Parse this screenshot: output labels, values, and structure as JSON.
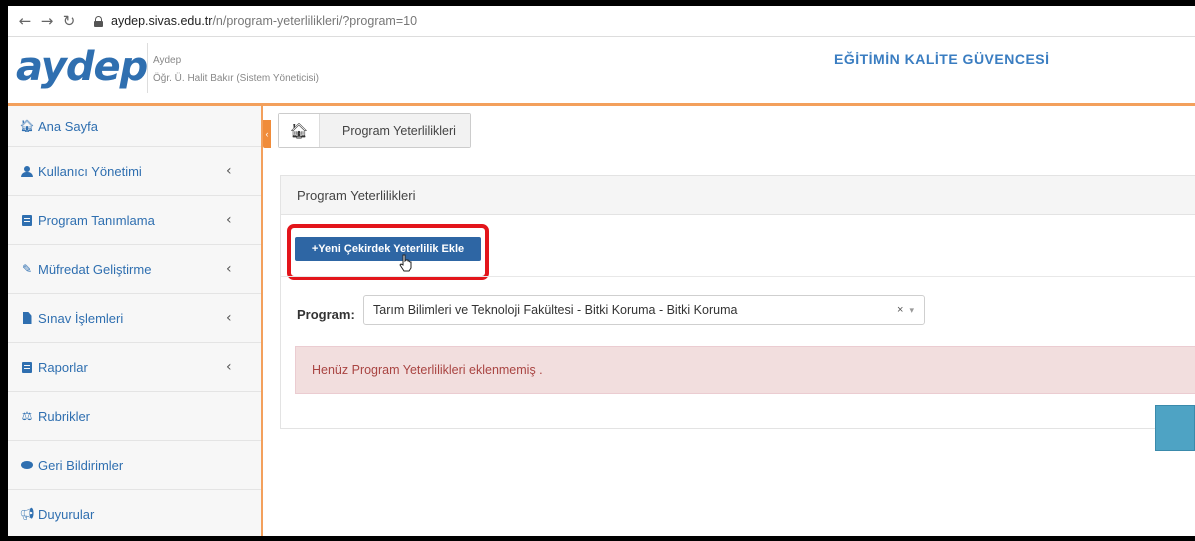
{
  "browser": {
    "url_host": "aydep.sivas.edu.tr",
    "url_path": "/n/program-yeterlilikleri/?program=10"
  },
  "header": {
    "logo": "aydep",
    "site_name": "Aydep",
    "user_info": "Öğr. Ü. Halit Bakır (Sistem Yöneticisi)",
    "motto": "EĞİTİMİN KALİTE GÜVENCESİ"
  },
  "sidebar": {
    "items": [
      {
        "label": "Ana Sayfa",
        "icon": "home-icon",
        "has_submenu": false
      },
      {
        "label": "Kullanıcı Yönetimi",
        "icon": "user-icon",
        "has_submenu": true
      },
      {
        "label": "Program Tanımlama",
        "icon": "book-icon",
        "has_submenu": true
      },
      {
        "label": "Müfredat Geliştirme",
        "icon": "pencil-icon",
        "has_submenu": true
      },
      {
        "label": "Sınav İşlemleri",
        "icon": "file-icon",
        "has_submenu": true
      },
      {
        "label": "Raporlar",
        "icon": "report-icon",
        "has_submenu": true
      },
      {
        "label": "Rubrikler",
        "icon": "balance-scale-icon",
        "has_submenu": false
      },
      {
        "label": "Geri Bildirimler",
        "icon": "comment-icon",
        "has_submenu": false
      },
      {
        "label": "Duyurular",
        "icon": "bullhorn-icon",
        "has_submenu": false
      }
    ]
  },
  "breadcrumb": {
    "current": "Program Yeterlilikleri"
  },
  "panel": {
    "title": "Program Yeterlilikleri",
    "add_button": "+Yeni Çekirdek Yeterlilik Ekle",
    "program_label": "Program:",
    "program_value": "Tarım Bilimleri ve Teknoloji Fakültesi - Bitki Koruma - Bitki Koruma",
    "clear_symbol": "×",
    "caret_symbol": "▾",
    "empty_message": "Henüz Program Yeterlilikleri eklenmemiş ."
  },
  "colors": {
    "brand_blue": "#2f6fb0",
    "accent_orange": "#f3a05c",
    "button_blue": "#2e66a4",
    "highlight_red": "#e3151b",
    "alert_bg": "#f2dede",
    "alert_text": "#a94442"
  }
}
